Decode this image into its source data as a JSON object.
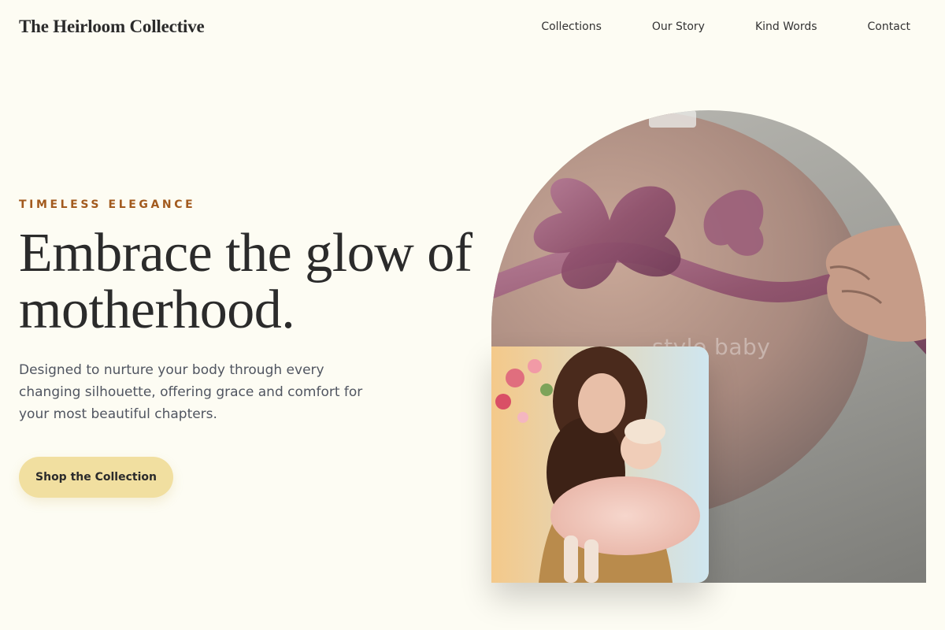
{
  "header": {
    "brand": "The Heirloom Collective",
    "nav": [
      "Collections",
      "Our Story",
      "Kind Words",
      "Contact"
    ]
  },
  "hero": {
    "eyebrow": "TIMELESS ELEGANCE",
    "headline": "Embrace the glow of motherhood.",
    "description": "Designed to nurture your body through every changing silhouette, offering grace and comfort for your most beautiful chapters.",
    "cta_label": "Shop the Collection"
  },
  "images": {
    "arch_overlay_text": "style baby",
    "arch_subject": "pregnant-belly-ribbon-photo",
    "inset_subject": "mother-holding-baby-photo"
  },
  "colors": {
    "background": "#fdfcf3",
    "accent": "#a25a1e",
    "cta": "#f1dfa0",
    "text": "#2b2b2b"
  }
}
